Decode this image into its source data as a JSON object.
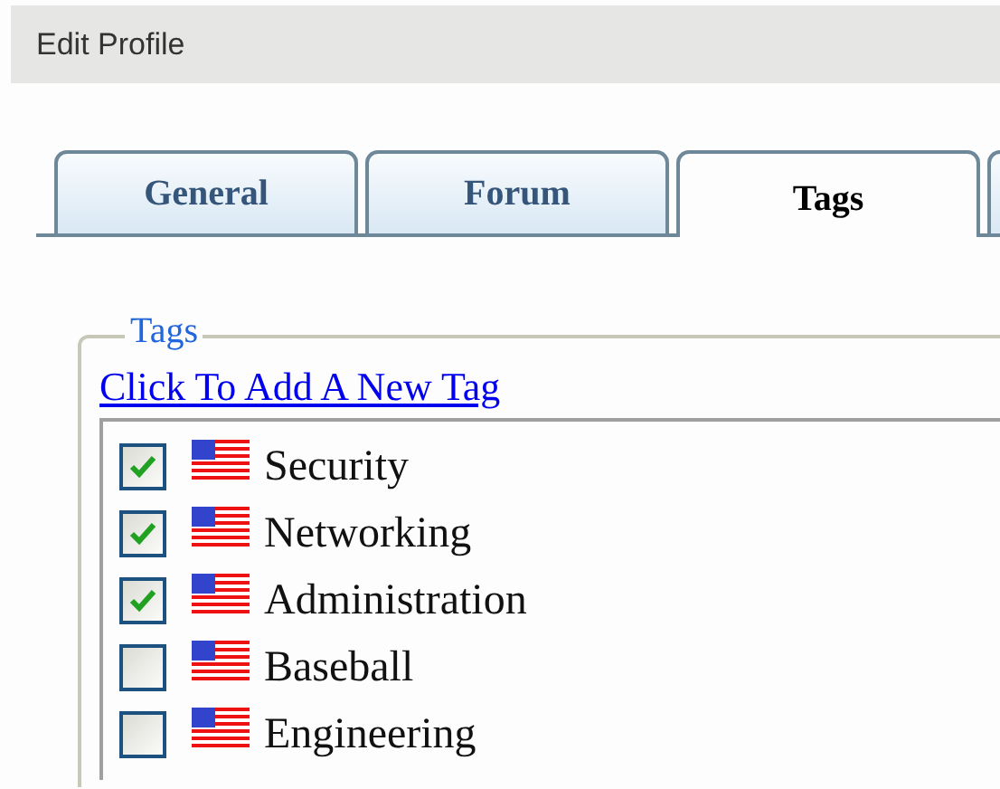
{
  "header": {
    "title": "Edit Profile"
  },
  "tabs": [
    {
      "label": "General",
      "selected": false
    },
    {
      "label": "Forum",
      "selected": false
    },
    {
      "label": "Tags",
      "selected": true
    }
  ],
  "fieldset": {
    "legend": "Tags",
    "add_link": "Click To Add A New Tag",
    "tags": [
      {
        "label": "Security",
        "checked": true
      },
      {
        "label": "Networking",
        "checked": true
      },
      {
        "label": "Administration",
        "checked": true
      },
      {
        "label": "Baseball",
        "checked": false
      },
      {
        "label": "Engineering",
        "checked": false
      }
    ]
  }
}
